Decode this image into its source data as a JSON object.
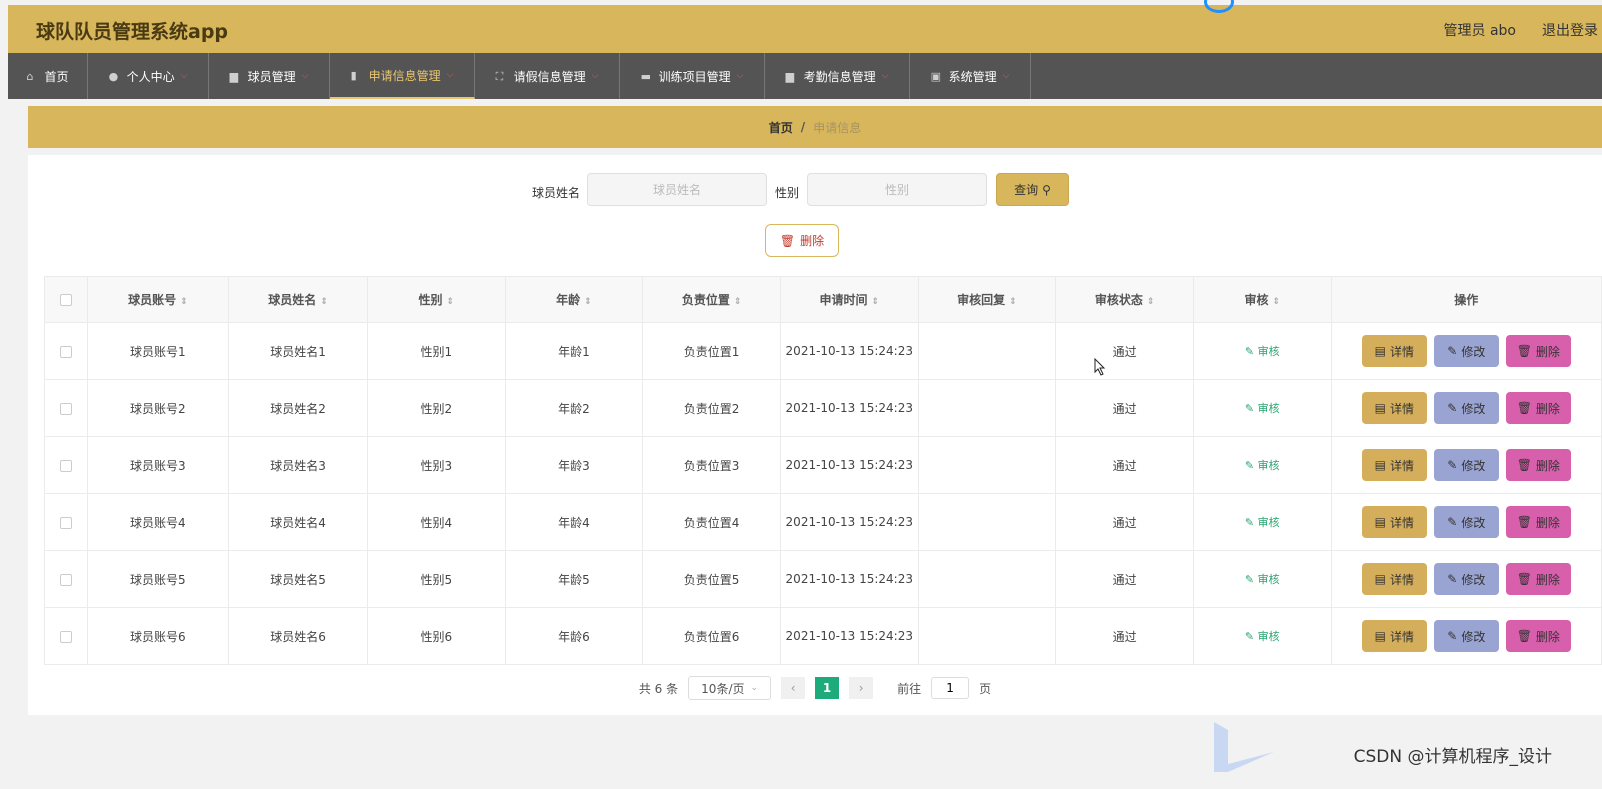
{
  "app": {
    "title": "球队队员管理系统app",
    "user": "管理员 abo",
    "logout": "退出登录"
  },
  "nav": [
    {
      "label": "首页",
      "icon": "home-icon",
      "has_menu": false
    },
    {
      "label": "个人中心",
      "icon": "user-icon",
      "has_menu": true
    },
    {
      "label": "球员管理",
      "icon": "folder-icon",
      "has_menu": true
    },
    {
      "label": "申请信息管理",
      "icon": "columns-icon",
      "has_menu": true,
      "active": true
    },
    {
      "label": "请假信息管理",
      "icon": "expand-icon",
      "has_menu": true
    },
    {
      "label": "训练项目管理",
      "icon": "chat-icon",
      "has_menu": true
    },
    {
      "label": "考勤信息管理",
      "icon": "bar-chart-icon",
      "has_menu": true
    },
    {
      "label": "系统管理",
      "icon": "clipboard-icon",
      "has_menu": true
    }
  ],
  "breadcrumb": {
    "home": "首页",
    "sep": "/",
    "current": "申请信息"
  },
  "search": {
    "name_label": "球员姓名",
    "name_placeholder": "球员姓名",
    "gender_label": "性别",
    "gender_placeholder": "性别",
    "query_label": "查询"
  },
  "bulk_delete_label": "删除",
  "table": {
    "columns": [
      "球员账号",
      "球员姓名",
      "性别",
      "年龄",
      "负责位置",
      "申请时间",
      "审核回复",
      "审核状态",
      "审核",
      "操作"
    ],
    "rows": [
      {
        "account": "球员账号1",
        "name": "球员姓名1",
        "gender": "性别1",
        "age": "年龄1",
        "position": "负责位置1",
        "time": "2021-10-13 15:24:23",
        "reply": "",
        "status": "通过"
      },
      {
        "account": "球员账号2",
        "name": "球员姓名2",
        "gender": "性别2",
        "age": "年龄2",
        "position": "负责位置2",
        "time": "2021-10-13 15:24:23",
        "reply": "",
        "status": "通过"
      },
      {
        "account": "球员账号3",
        "name": "球员姓名3",
        "gender": "性别3",
        "age": "年龄3",
        "position": "负责位置3",
        "time": "2021-10-13 15:24:23",
        "reply": "",
        "status": "通过"
      },
      {
        "account": "球员账号4",
        "name": "球员姓名4",
        "gender": "性别4",
        "age": "年龄4",
        "position": "负责位置4",
        "time": "2021-10-13 15:24:23",
        "reply": "",
        "status": "通过"
      },
      {
        "account": "球员账号5",
        "name": "球员姓名5",
        "gender": "性别5",
        "age": "年龄5",
        "position": "负责位置5",
        "time": "2021-10-13 15:24:23",
        "reply": "",
        "status": "通过"
      },
      {
        "account": "球员账号6",
        "name": "球员姓名6",
        "gender": "性别6",
        "age": "年龄6",
        "position": "负责位置6",
        "time": "2021-10-13 15:24:23",
        "reply": "",
        "status": "通过"
      }
    ],
    "audit_label": "审核",
    "actions": {
      "detail": "详情",
      "edit": "修改",
      "delete": "删除"
    }
  },
  "pager": {
    "total": "共 6 条",
    "page_size": "10条/页",
    "current_page": "1",
    "goto_label": "前往",
    "goto_value": "1",
    "page_unit": "页"
  },
  "watermark": "CSDN @计算机程序_设计",
  "colors": {
    "header": "#d7b65c",
    "nav": "#545454",
    "active": "#e8c66f",
    "detail": "#d4ae5a",
    "edit": "#9aa4d2",
    "delete": "#d85fac",
    "page": "#1dab7c"
  }
}
